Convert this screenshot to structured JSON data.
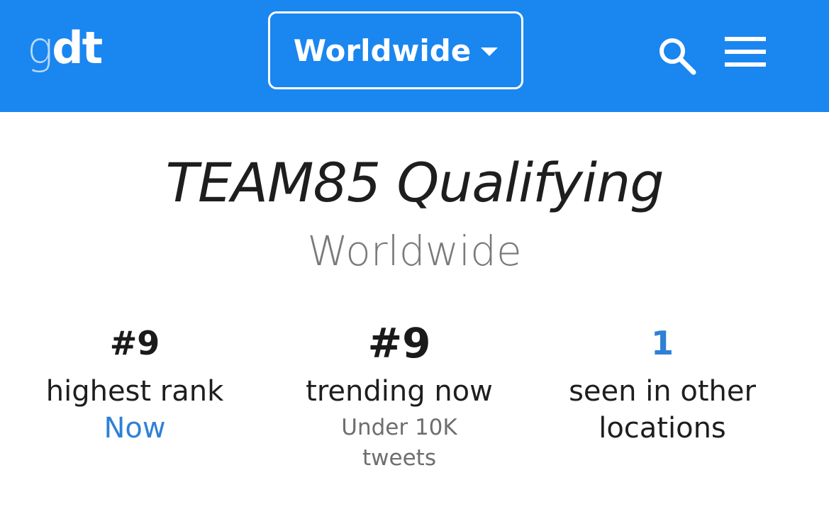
{
  "header": {
    "logo_prefix": "g",
    "logo_rest": "dt",
    "location": "Worldwide",
    "colors": {
      "bar": "#1a86f0",
      "logo_prefix": "#b8d9fb"
    },
    "icons": [
      "search-icon",
      "hamburger-menu-icon",
      "chevron-down-icon"
    ]
  },
  "trend": {
    "title": "TEAM85 Qualifying",
    "location": "Worldwide"
  },
  "stats": {
    "highest": {
      "value": "#9",
      "label": "highest rank",
      "sub": "Now"
    },
    "trending": {
      "value": "#9",
      "label": "trending now",
      "sub_line1": "Under 10K",
      "sub_line2": "tweets"
    },
    "other": {
      "value": "1",
      "label_line1": "seen in other",
      "label_line2": "locations"
    }
  },
  "colors": {
    "accent_blue": "#2f80d6",
    "text_dark": "#1e1e1e",
    "text_grey": "#7a7a7a"
  }
}
